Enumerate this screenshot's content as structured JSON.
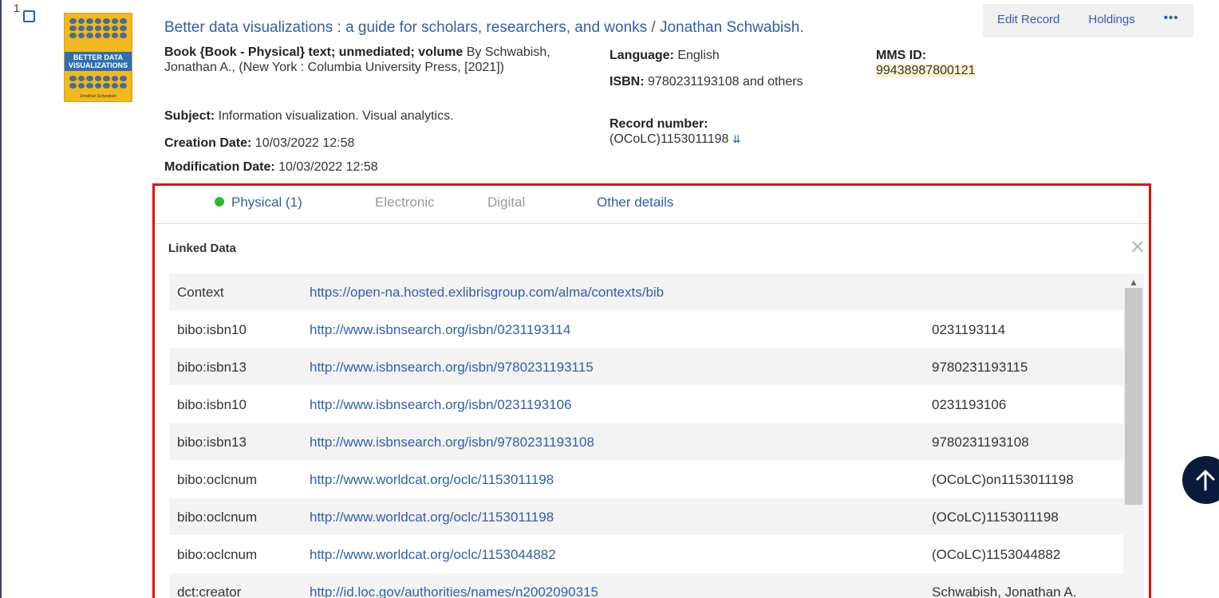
{
  "record": {
    "number": "1",
    "title": "Better data visualizations : a guide for scholars, researchers, and wonks / Jonathan Schwabish.",
    "thumbnail": {
      "title": "BETTER DATA VISUALIZATIONS",
      "author": "Jonathan Schwabish"
    },
    "actions": {
      "edit": "Edit Record",
      "holdings": "Holdings",
      "more": "•••"
    },
    "format_label": "Book {Book - Physical} text; unmediated; volume",
    "by_text": " By Schwabish, Jonathan A., (New York : Columbia University Press, [2021])",
    "subject_label": "Subject:",
    "subject_value": " Information visualization. Visual analytics.",
    "creation_label": "Creation Date:",
    "creation_value": " 10/03/2022 12:58",
    "modification_label": "Modification Date:",
    "modification_value": " 10/03/2022 12:58",
    "language_label": "Language:",
    "language_value": " English",
    "isbn_label": "ISBN:",
    "isbn_value": " 9780231193108 and others",
    "record_number_label": "Record number:",
    "record_number_value": "(OCoLC)1153011198",
    "mms_label": "MMS ID:",
    "mms_value": "99438987800121"
  },
  "tabs": [
    {
      "label": "Physical (1)",
      "state": "active"
    },
    {
      "label": "Electronic",
      "state": "disabled"
    },
    {
      "label": "Digital",
      "state": "disabled"
    },
    {
      "label": "Other details",
      "state": "link"
    }
  ],
  "linked_data": {
    "heading": "Linked Data",
    "close": "✕",
    "rows": [
      {
        "key": "Context",
        "url": "https://open-na.hosted.exlibrisgroup.com/alma/contexts/bib",
        "value": ""
      },
      {
        "key": "bibo:isbn10",
        "url": "http://www.isbnsearch.org/isbn/0231193114",
        "value": "0231193114"
      },
      {
        "key": "bibo:isbn13",
        "url": "http://www.isbnsearch.org/isbn/9780231193115",
        "value": "9780231193115"
      },
      {
        "key": "bibo:isbn10",
        "url": "http://www.isbnsearch.org/isbn/0231193106",
        "value": "0231193106"
      },
      {
        "key": "bibo:isbn13",
        "url": "http://www.isbnsearch.org/isbn/9780231193108",
        "value": "9780231193108"
      },
      {
        "key": "bibo:oclcnum",
        "url": "http://www.worldcat.org/oclc/1153011198",
        "value": "(OCoLC)on1153011198"
      },
      {
        "key": "bibo:oclcnum",
        "url": "http://www.worldcat.org/oclc/1153011198",
        "value": "(OCoLC)1153011198"
      },
      {
        "key": "bibo:oclcnum",
        "url": "http://www.worldcat.org/oclc/1153044882",
        "value": "(OCoLC)1153044882"
      },
      {
        "key": "dct:creator",
        "url": "http://id.loc.gov/authorities/names/n2002090315",
        "value": "Schwabish, Jonathan A."
      }
    ]
  },
  "icons": {
    "scroll_up": "scroll-up-arrow-icon",
    "back_to_top": "arrow-up-icon",
    "status_dot": "green-dot-icon"
  },
  "colors": {
    "link": "#2f5fa7",
    "highlight_border": "#e01010",
    "status_green": "#2eb82e",
    "mms_highlight": "#fdf3d0"
  }
}
